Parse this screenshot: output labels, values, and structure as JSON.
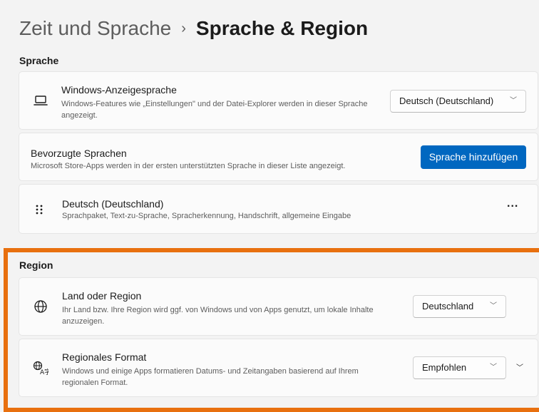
{
  "breadcrumb": {
    "parent": "Zeit und Sprache",
    "separator": "›",
    "current": "Sprache & Region"
  },
  "sections": {
    "language": "Sprache",
    "region": "Region"
  },
  "display_language": {
    "icon": "laptop-icon",
    "title": "Windows-Anzeigesprache",
    "description": "Windows-Features wie „Einstellungen\" und der Datei-Explorer werden in dieser Sprache angezeigt.",
    "value": "Deutsch (Deutschland)"
  },
  "preferred_languages": {
    "title": "Bevorzugte Sprachen",
    "description": "Microsoft Store-Apps werden in der ersten unterstützten Sprache in dieser Liste angezeigt.",
    "add_button": "Sprache hinzufügen"
  },
  "language_item": {
    "icon": "drag-handle-icon",
    "title": "Deutsch (Deutschland)",
    "description": "Sprachpaket, Text-zu-Sprache, Spracherkennung, Handschrift, allgemeine Eingabe",
    "more": "..."
  },
  "country": {
    "icon": "globe-icon",
    "title": "Land oder Region",
    "description": "Ihr Land bzw. Ihre Region wird ggf. von Windows und von Apps genutzt, um lokale Inhalte anzuzeigen.",
    "value": "Deutschland"
  },
  "regional_format": {
    "icon": "language-format-icon",
    "title": "Regionales Format",
    "description": "Windows und einige Apps formatieren Datums- und Zeitangaben basierend auf Ihrem regionalen Format.",
    "value": "Empfohlen"
  },
  "colors": {
    "accent": "#0067c0",
    "highlight": "#e8700f"
  }
}
